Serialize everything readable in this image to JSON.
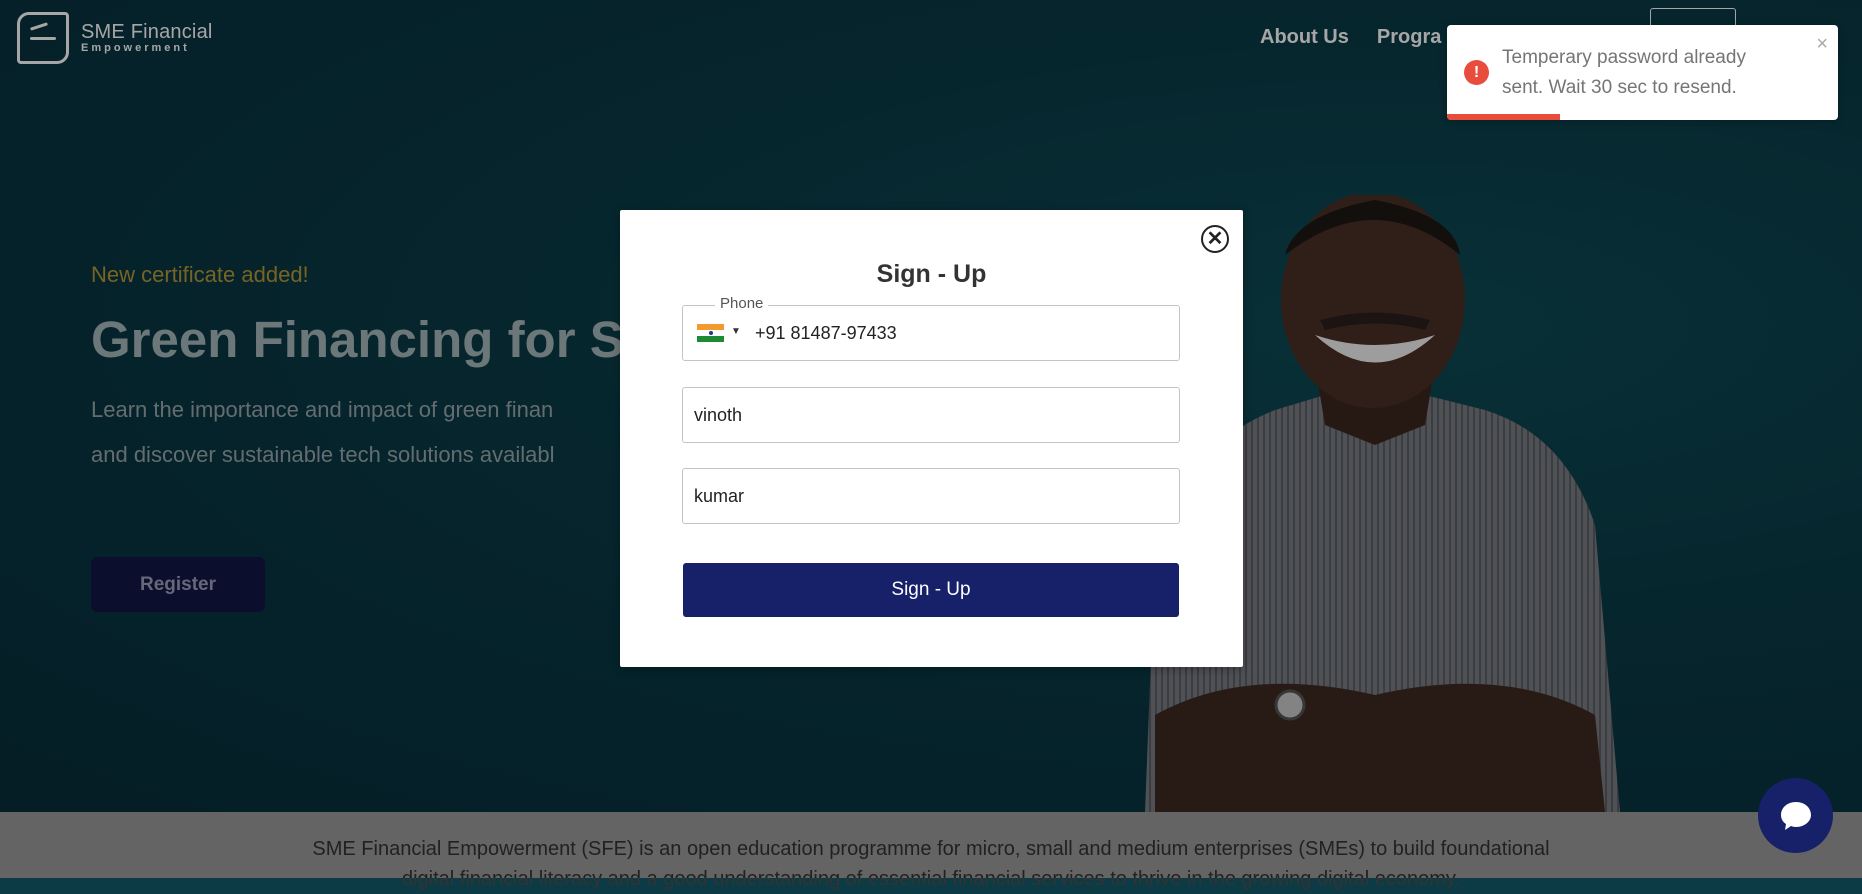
{
  "header": {
    "logo_line1": "SME Financial",
    "logo_line2": "Empowerment",
    "nav": [
      "About Us",
      "Progra"
    ]
  },
  "hero": {
    "tagline": "New certificate added!",
    "headline": "Green Financing for SI",
    "desc_line1": "Learn the importance and impact of green finan",
    "desc_line2": "and discover sustainable tech solutions availabl",
    "register_label": "Register"
  },
  "modal": {
    "title": "Sign - Up",
    "phone_label": "Phone",
    "phone_value": "+91 81487-97433",
    "first_name_value": "vinoth",
    "last_name_value": "kumar",
    "submit_label": "Sign - Up",
    "close_glyph": "✕"
  },
  "toast": {
    "message": "Temperary password already sent. Wait 30 sec to resend.",
    "icon": "!",
    "close_glyph": "×",
    "progress_fraction": 0.29
  },
  "footer": {
    "intro_line1": "SME Financial Empowerment (SFE) is an open education programme for micro, small and medium enterprises (SMEs) to build foundational",
    "intro_line2": "digital financial literacy and a good understanding of essential financial services to thrive in the growing digital economy."
  },
  "colors": {
    "accent": "#16216a",
    "error": "#e74c3c",
    "hero_bg": "#0a3a46"
  }
}
